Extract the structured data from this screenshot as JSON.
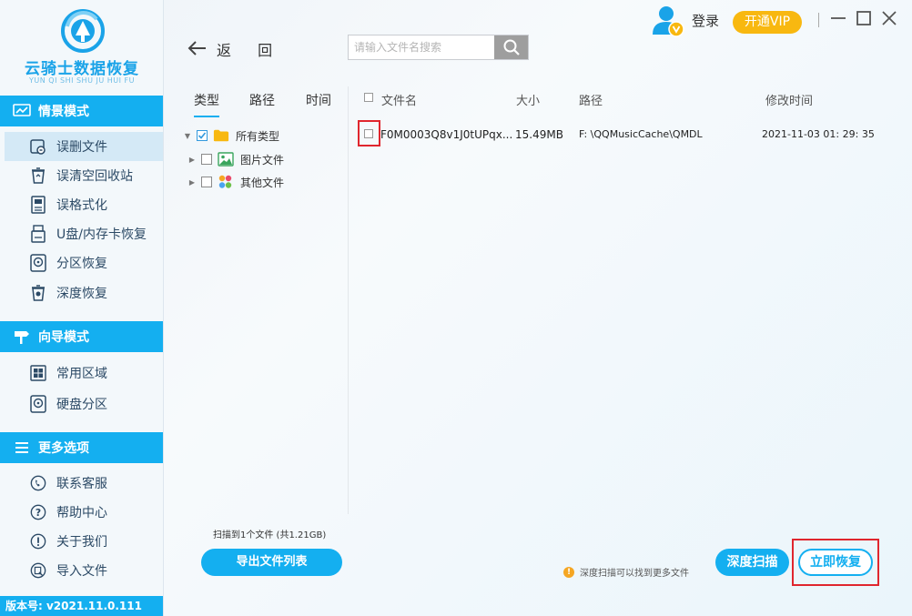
{
  "app": {
    "title": "云骑士数据恢复",
    "subtitle": "YUN QI SHI SHU JU HUI FU",
    "version": "版本号: v2021.11.0.111"
  },
  "colors": {
    "accent": "#14aff0",
    "vip": "#f8b810",
    "highlight": "#e0262e"
  },
  "sidebar": {
    "sections": [
      {
        "title": "情景模式",
        "icon": "scene-icon",
        "items": [
          {
            "label": "误删文件",
            "icon": "deleted-file-icon",
            "active": true
          },
          {
            "label": "误清空回收站",
            "icon": "recycle-bin-icon"
          },
          {
            "label": "误格式化",
            "icon": "format-icon"
          },
          {
            "label": "U盘/内存卡恢复",
            "icon": "usb-card-icon"
          },
          {
            "label": "分区恢复",
            "icon": "partition-icon"
          },
          {
            "label": "深度恢复",
            "icon": "deep-recover-icon"
          }
        ]
      },
      {
        "title": "向导模式",
        "icon": "signpost-icon",
        "items": [
          {
            "label": "常用区域",
            "icon": "windows-icon"
          },
          {
            "label": "硬盘分区",
            "icon": "disk-partition-icon"
          }
        ]
      },
      {
        "title": "更多选项",
        "icon": "menu-icon",
        "items": [
          {
            "label": "联系客服",
            "icon": "phone-icon"
          },
          {
            "label": "帮助中心",
            "icon": "help-icon"
          },
          {
            "label": "关于我们",
            "icon": "info-icon"
          },
          {
            "label": "导入文件",
            "icon": "import-icon"
          }
        ]
      }
    ]
  },
  "header": {
    "back_label": "返 回",
    "search_placeholder": "请输入文件名搜索",
    "login_label": "登录",
    "vip_label": "开通VIP"
  },
  "filter": {
    "tabs": [
      "类型",
      "路径",
      "时间"
    ],
    "tree": [
      {
        "label": "所有类型",
        "checked": true,
        "icon": "folder-icon"
      },
      {
        "label": "图片文件",
        "checked": false,
        "icon": "image-file-icon"
      },
      {
        "label": "其他文件",
        "checked": false,
        "icon": "other-files-icon"
      }
    ]
  },
  "file_list": {
    "columns": [
      "文件名",
      "大小",
      "路径",
      "修改时间"
    ],
    "rows": [
      {
        "name": "F0M0003Q8v1J0tUPqx...",
        "size": "15.49MB",
        "path": "F: \\QQMusicCache\\QMDL",
        "modified": "2021-11-03 01: 29: 35",
        "checked": false
      }
    ]
  },
  "footer": {
    "scan_summary": "扫描到1个文件 (共1.21GB)",
    "export_label": "导出文件列表",
    "tip_text": "深度扫描可以找到更多文件",
    "deep_scan_label": "深度扫描",
    "recover_label": "立即恢复"
  }
}
